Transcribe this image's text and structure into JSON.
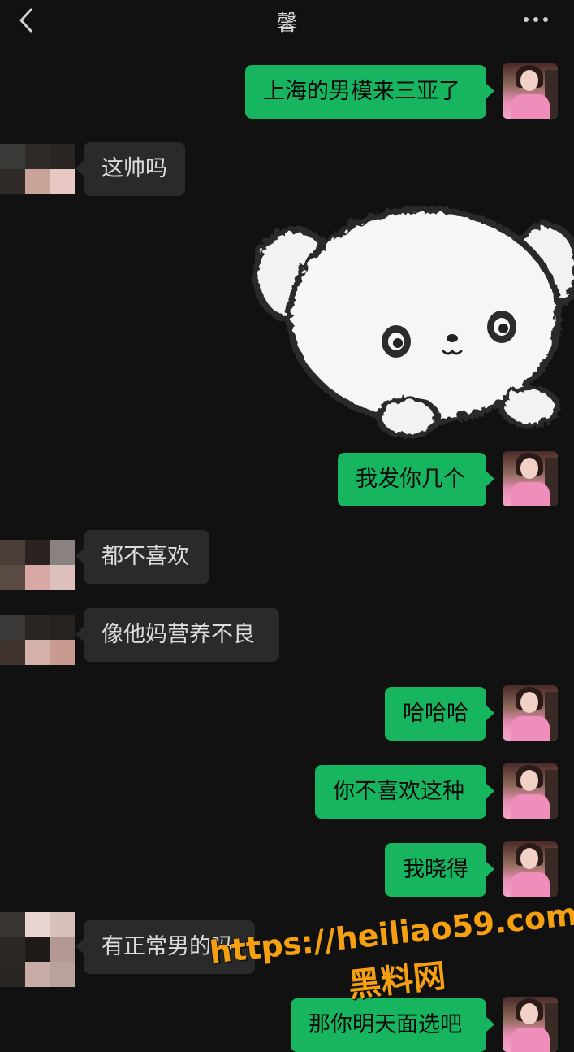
{
  "header": {
    "title": "馨",
    "back_icon": "chevron-left-icon",
    "more_icon": "more-dots-icon"
  },
  "messages": [
    {
      "side": "out",
      "text": "上海的男模来三亚了"
    },
    {
      "side": "in",
      "text": "这帅吗"
    },
    {
      "side": "out",
      "type": "sticker",
      "sticker": "white-fluffy-dog-sticker"
    },
    {
      "side": "out",
      "text": "我发你几个"
    },
    {
      "side": "in",
      "text": "都不喜欢"
    },
    {
      "side": "in",
      "text": "像他妈营养不良"
    },
    {
      "side": "out",
      "text": "哈哈哈"
    },
    {
      "side": "out",
      "text": "你不喜欢这种"
    },
    {
      "side": "out",
      "text": "我晓得"
    },
    {
      "side": "in",
      "text": "有正常男的吗"
    },
    {
      "side": "out",
      "text": "那你明天面选吧"
    }
  ],
  "watermark": {
    "url": "https://heiliao59.com",
    "name": "黑料网",
    "color": "#f5a011"
  },
  "colors": {
    "background": "#111111",
    "outgoing_bubble": "#17b55f",
    "incoming_bubble": "#2a2a2a"
  }
}
